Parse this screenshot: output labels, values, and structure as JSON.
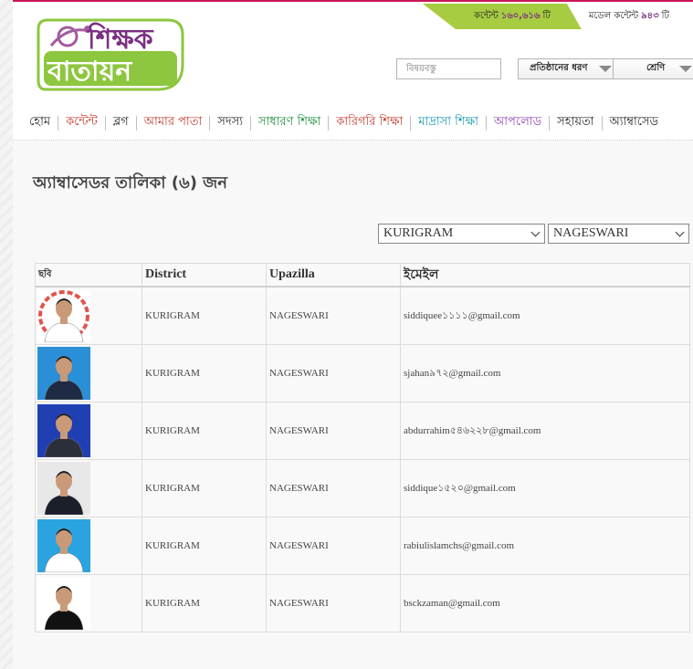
{
  "header": {
    "stats": [
      {
        "label": "কন্টেন্ট",
        "value": "১৬০,৬১৬",
        "unit": "টি"
      },
      {
        "label": "মডেল কন্টেন্ট",
        "value": "৯৪৩",
        "unit": "টি"
      }
    ],
    "logo": {
      "line1": "শিক্ষক",
      "line2": "বাতায়ন"
    },
    "search_placeholder": "বিষয়বস্তু",
    "institution_select": "প্রতিষ্ঠানের ধরণ",
    "class_select": "শ্রেণি"
  },
  "nav": [
    {
      "label": "হোম",
      "color": "#222222"
    },
    {
      "label": "কন্টেন্ট",
      "color": "#c0392b"
    },
    {
      "label": "ব্লগ",
      "color": "#222222"
    },
    {
      "label": "আমার পাতা",
      "color": "#c0392b"
    },
    {
      "label": "সদস্য",
      "color": "#222222"
    },
    {
      "label": "সাধারণ শিক্ষা",
      "color": "#1e8e3e"
    },
    {
      "label": "কারিগরি শিক্ষা",
      "color": "#c0392b"
    },
    {
      "label": "মাদ্রাসা শিক্ষা",
      "color": "#1a9ab3"
    },
    {
      "label": "আপলোড",
      "color": "#8e44ad"
    },
    {
      "label": "সহায়তা",
      "color": "#222222"
    },
    {
      "label": "অ্যাম্বাসেড",
      "color": "#222222"
    }
  ],
  "main": {
    "title": "অ্যাম্বাসেডর তালিকা (৬) জন",
    "filters": {
      "district": "KURIGRAM",
      "upazila": "NAGESWARI"
    },
    "table": {
      "headers": [
        "ছবি",
        "District",
        "Upazilla",
        "ইমেইল"
      ],
      "rows": [
        {
          "district": "KURIGRAM",
          "upazila": "NAGESWARI",
          "email": "siddiquee১১১১@gmail.com",
          "photo_bg": "#ffffff",
          "shirt": "#ffffff"
        },
        {
          "district": "KURIGRAM",
          "upazila": "NAGESWARI",
          "email": "sjahan৯৭২@gmail.com",
          "photo_bg": "#2a8fd6",
          "shirt": "#1f2a44"
        },
        {
          "district": "KURIGRAM",
          "upazila": "NAGESWARI",
          "email": "abdurrahim৫৪৬২২৮@gmail.com",
          "photo_bg": "#1f3fb3",
          "shirt": "#2b2f3a"
        },
        {
          "district": "KURIGRAM",
          "upazila": "NAGESWARI",
          "email": "siddique১৫২০@gmail.com",
          "photo_bg": "#e8e8e8",
          "shirt": "#1b1f2a"
        },
        {
          "district": "KURIGRAM",
          "upazila": "NAGESWARI",
          "email": "rabiulislamchs@gmail.com",
          "photo_bg": "#2aa3e0",
          "shirt": "#ffffff"
        },
        {
          "district": "KURIGRAM",
          "upazila": "NAGESWARI",
          "email": "bsckzaman@gmail.com",
          "photo_bg": "#ffffff",
          "shirt": "#111111"
        }
      ]
    }
  }
}
